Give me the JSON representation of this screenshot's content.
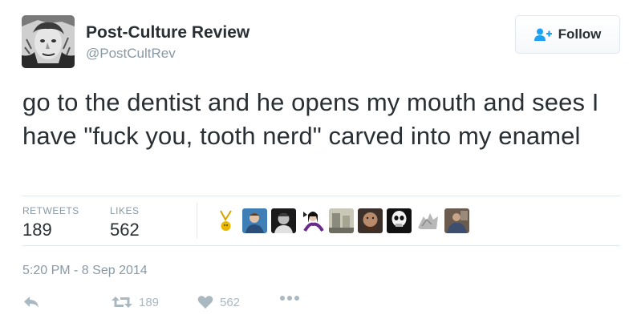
{
  "author": {
    "display_name": "Post-Culture Review",
    "handle": "@PostCultRev"
  },
  "follow_button": {
    "label": "Follow"
  },
  "tweet": {
    "text": "go to the dentist and he opens my mouth and sees I have \"fuck you, tooth nerd\" carved into my enamel",
    "timestamp": "5:20 PM - 8 Sep 2014"
  },
  "stats": {
    "retweets_label": "RETWEETS",
    "retweets_count": "189",
    "likes_label": "LIKES",
    "likes_count": "562"
  },
  "actions": {
    "retweet_count": "189",
    "like_count": "562"
  },
  "colors": {
    "text": "#292f33",
    "muted": "#8899a6",
    "divider": "#e1e8ed",
    "action_icon": "#aab8c2",
    "follow_icon": "#1da1f2"
  },
  "icons": {
    "follow": "person-plus-icon",
    "reply": "reply-icon",
    "retweet": "retweet-icon",
    "like": "heart-icon",
    "more": "more-dots-icon"
  }
}
